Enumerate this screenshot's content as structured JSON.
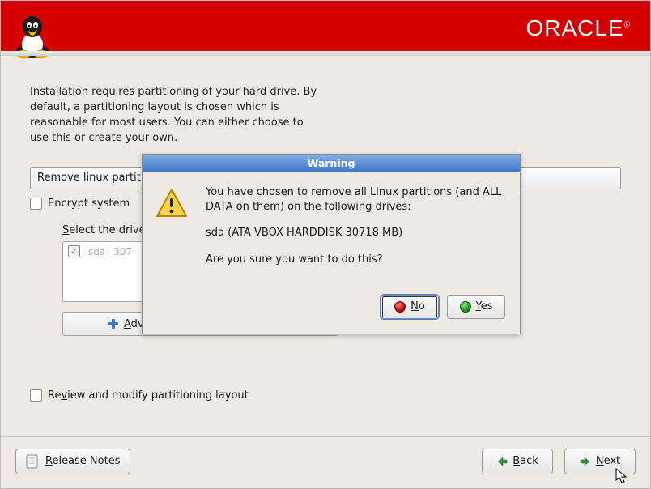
{
  "header": {
    "logo_text": "ORACLE"
  },
  "intro": "Installation requires partitioning of your hard drive. By default, a partitioning layout is chosen which is reasonable for most users.  You can either choose to use this or create your own.",
  "combo_text": "Remove linux partit",
  "encrypt_label": "Encrypt system",
  "drives_label_prefix": "S",
  "drives_label_rest": "elect the drive",
  "drives": {
    "row1_dev": "sda",
    "row1_size": "307"
  },
  "adv_prefix": "A",
  "adv_rest": "dvanced storage configuration",
  "review_prefix": "Re",
  "review_u": "v",
  "review_rest": "iew and modify partitioning layout",
  "dialog": {
    "title": "Warning",
    "msg1": "You have chosen to remove all Linux partitions (and ALL DATA on them) on the following drives:",
    "msg2": "sda (ATA VBOX HARDDISK 30718 MB)",
    "msg3": "Are you sure you want to do this?",
    "no_u": "N",
    "no_rest": "o",
    "yes_u": "Y",
    "yes_rest": "es"
  },
  "footer": {
    "rel_u": "R",
    "rel_rest": "elease Notes",
    "back_u": "B",
    "back_rest": "ack",
    "next_u": "N",
    "next_rest": "ext"
  }
}
